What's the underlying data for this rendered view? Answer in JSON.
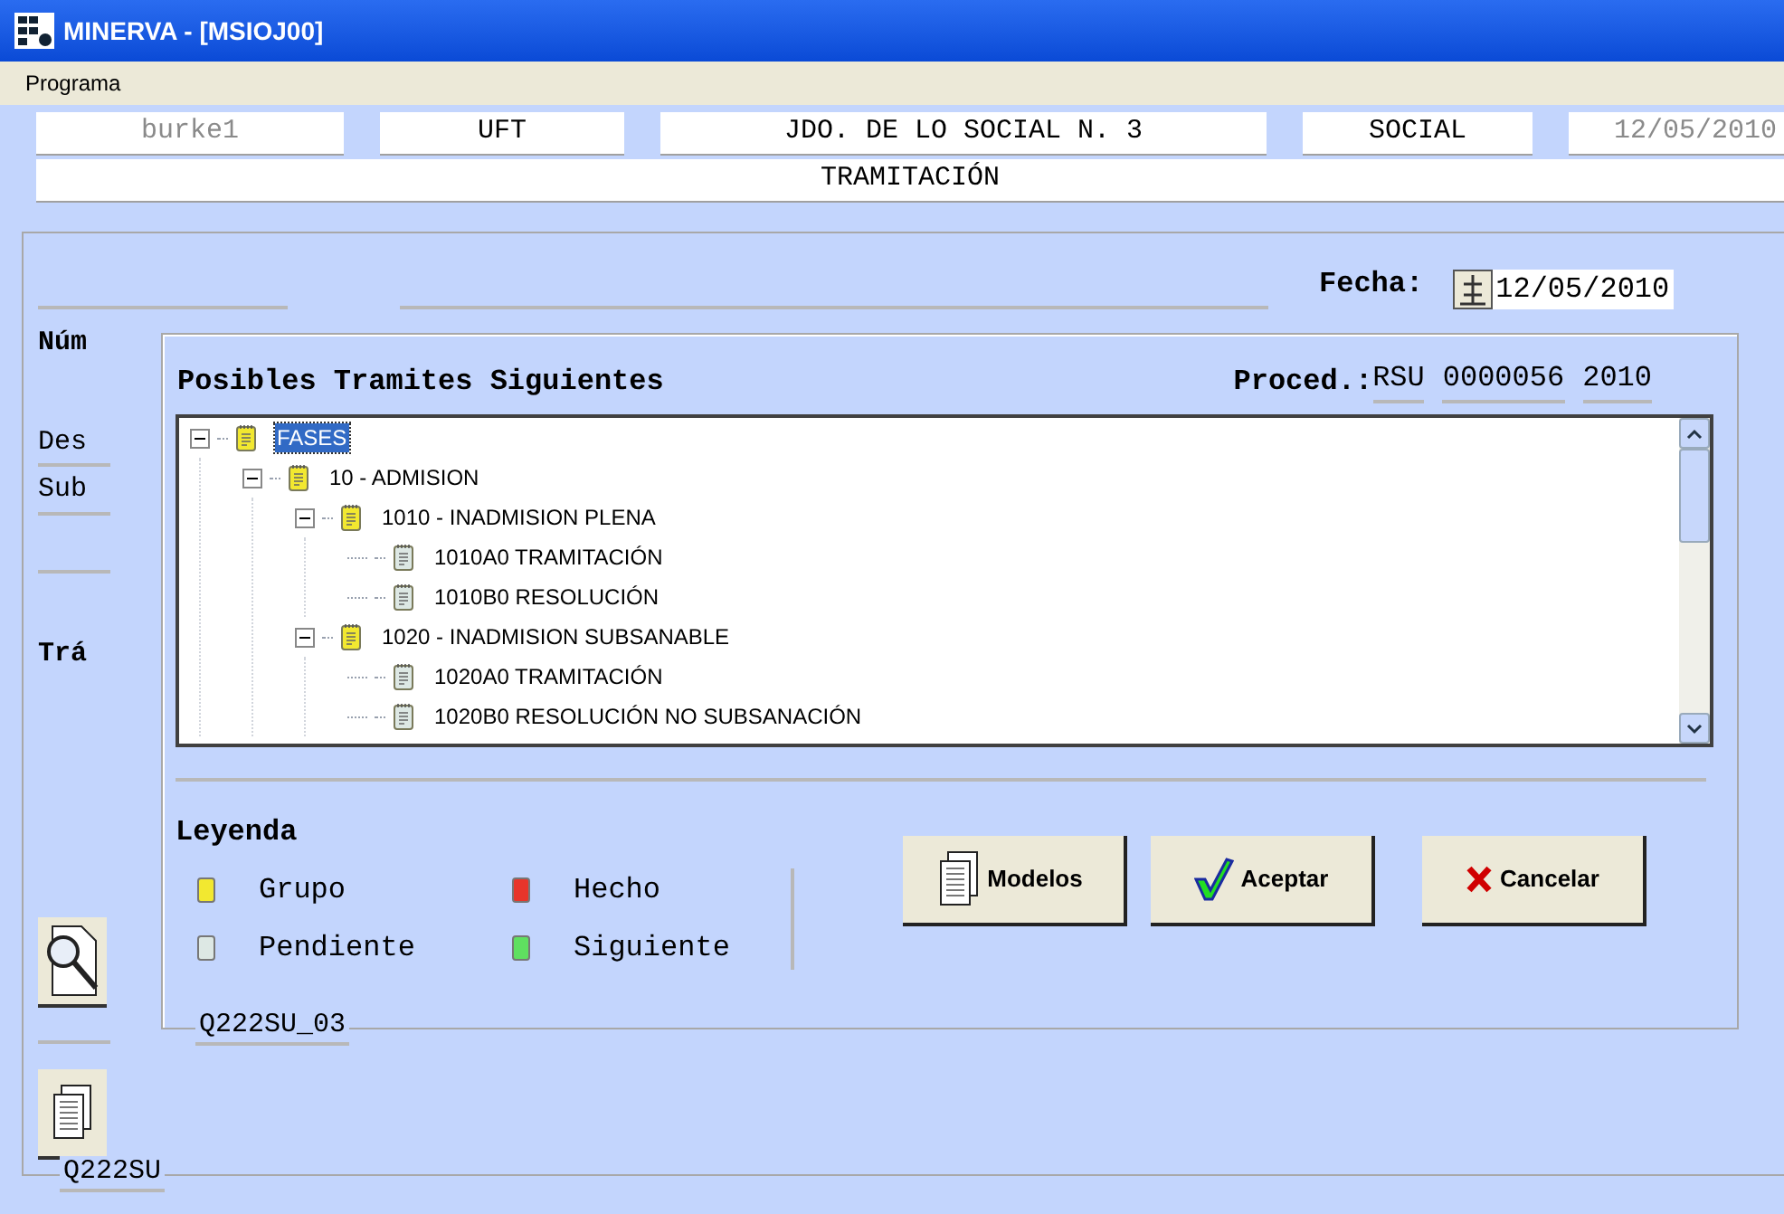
{
  "window": {
    "title": "MINERVA - [MSIOJ00]"
  },
  "menu": [
    "Programa"
  ],
  "header_fields": [
    {
      "value": "burke1",
      "disabled": true
    },
    {
      "value": "UFT",
      "disabled": false
    },
    {
      "value": "JDO. DE LO SOCIAL N. 3",
      "disabled": false
    },
    {
      "value": "SOCIAL",
      "disabled": false
    },
    {
      "value": "12/05/2010",
      "disabled": true
    }
  ],
  "section_title": "TRAMITACIÓN",
  "fecha": {
    "label": "Fecha:",
    "value": "12/05/2010"
  },
  "background_labels": [
    "Núm",
    "Des",
    "Sub",
    "Trá"
  ],
  "dialog": {
    "title": "Posibles Tramites Siguientes",
    "proced_label": "Proced.:",
    "proced_values": [
      "RSU",
      "0000056",
      "2010"
    ],
    "tree": [
      {
        "label": "FASES",
        "kind": "grupo",
        "selected": true,
        "expanded": true,
        "children": [
          {
            "label": "10 - ADMISION",
            "kind": "grupo",
            "selected": false,
            "expanded": true,
            "children": [
              {
                "label": "1010 - INADMISION PLENA",
                "kind": "grupo",
                "selected": false,
                "expanded": true,
                "children": [
                  {
                    "label": "1010A0 TRAMITACIÓN",
                    "kind": "pendiente",
                    "selected": false
                  },
                  {
                    "label": "1010B0 RESOLUCIÓN",
                    "kind": "pendiente",
                    "selected": false
                  }
                ]
              },
              {
                "label": "1020 - INADMISION SUBSANABLE",
                "kind": "grupo",
                "selected": false,
                "expanded": true,
                "children": [
                  {
                    "label": "1020A0 TRAMITACIÓN",
                    "kind": "pendiente",
                    "selected": false
                  },
                  {
                    "label": "1020B0 RESOLUCIÓN NO SUBSANACIÓN",
                    "kind": "pendiente",
                    "selected": false
                  }
                ]
              }
            ]
          }
        ]
      }
    ],
    "legend_title": "Leyenda",
    "legend": [
      {
        "label": "Grupo",
        "color": "#f2e830"
      },
      {
        "label": "Hecho",
        "color": "#e8352a"
      },
      {
        "label": "Pendiente",
        "color": "#dde8e4"
      },
      {
        "label": "Siguiente",
        "color": "#5fe060"
      }
    ],
    "buttons": [
      {
        "label": "Modelos",
        "kind": "models"
      },
      {
        "label": "Aceptar",
        "kind": "accept"
      },
      {
        "label": "Cancelar",
        "kind": "cancel"
      }
    ],
    "footer": "Q222SU_03"
  },
  "footer": "Q222SU"
}
